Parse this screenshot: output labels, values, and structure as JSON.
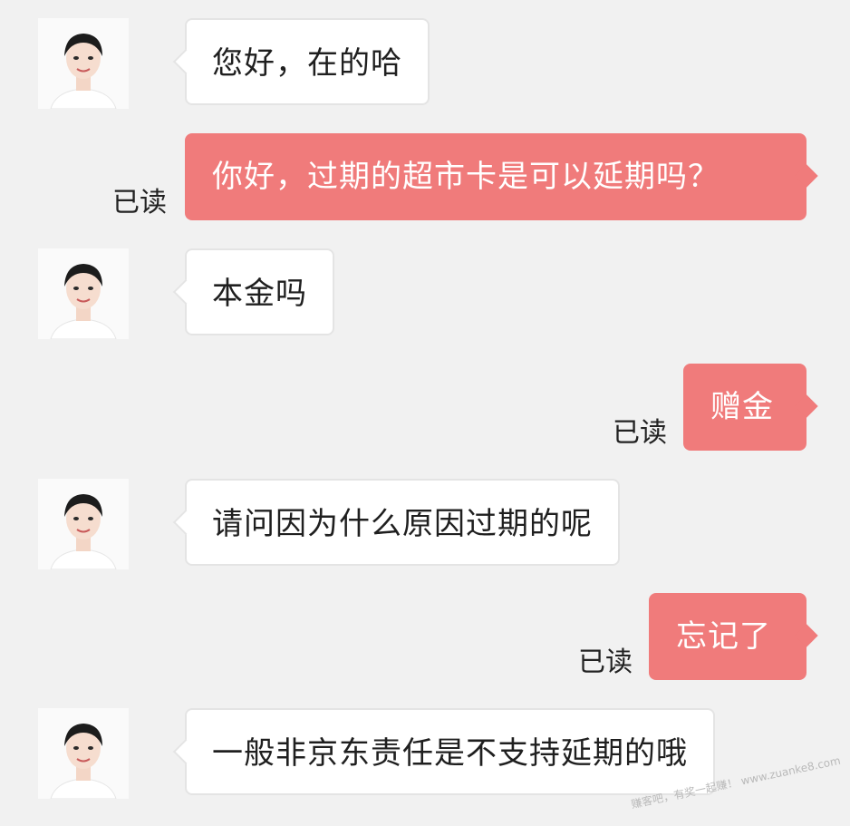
{
  "messages": [
    {
      "from": "agent",
      "text": "您好，在的哈",
      "avatar_icon": "agent-avatar"
    },
    {
      "from": "me",
      "text": "你好，过期的超市卡是可以延期吗？",
      "status": "已读"
    },
    {
      "from": "agent",
      "text": "本金吗",
      "avatar_icon": "agent-avatar"
    },
    {
      "from": "me",
      "text": "赠金",
      "status": "已读"
    },
    {
      "from": "agent",
      "text": "请问因为什么原因过期的呢",
      "avatar_icon": "agent-avatar"
    },
    {
      "from": "me",
      "text": "忘记了",
      "status": "已读"
    },
    {
      "from": "agent",
      "text": "一般非京东责任是不支持延期的哦",
      "avatar_icon": "agent-avatar"
    }
  ],
  "watermark": "赚客吧，有奖一起赚！ www.zuanke8.com",
  "colors": {
    "background": "#f1f1f1",
    "incoming_bubble": "#ffffff",
    "outgoing_bubble": "#f07b7b",
    "text": "#1f1f1f"
  }
}
